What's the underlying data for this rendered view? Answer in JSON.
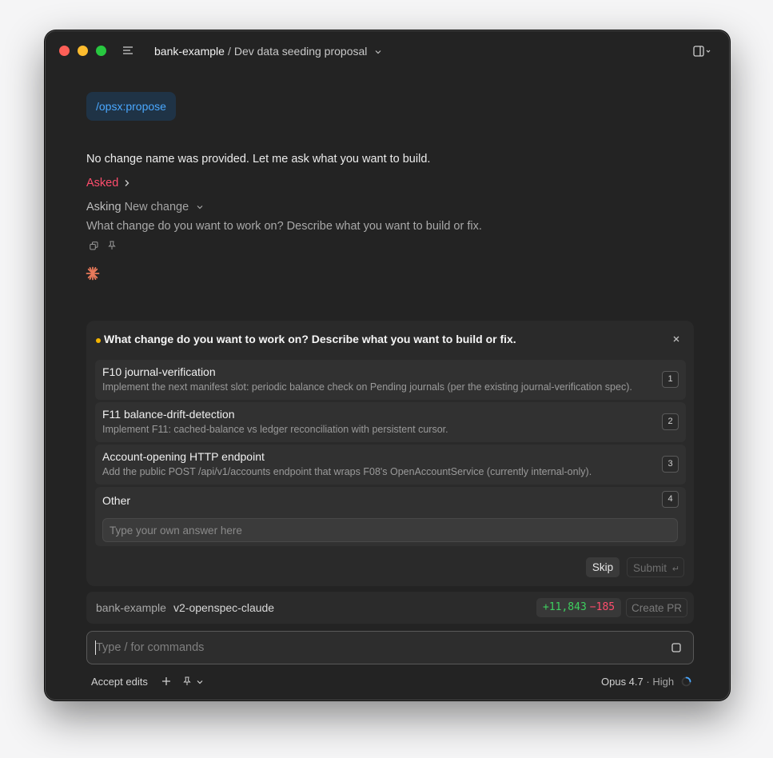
{
  "window": {
    "project": "bank-example",
    "separator": "/",
    "title": "Dev data seeding proposal"
  },
  "conversation": {
    "command_chip": "/opsx:propose",
    "assistant_message": "No change name was provided. Let me ask what you want to build.",
    "asked_label": "Asked",
    "asking_label": "Asking",
    "asking_value": "New change",
    "question": "What change do you want to work on? Describe what you want to build or fix."
  },
  "question_card": {
    "title": "What change do you want to work on? Describe what you want to build or fix.",
    "options": [
      {
        "label": "F10 journal-verification",
        "description": "Implement the next manifest slot: periodic balance check on Pending journals (per the existing journal-verification spec).",
        "key": "1"
      },
      {
        "label": "F11 balance-drift-detection",
        "description": "Implement F11: cached-balance vs ledger reconciliation with persistent cursor.",
        "key": "2"
      },
      {
        "label": "Account-opening HTTP endpoint",
        "description": "Add the public POST /api/v1/accounts endpoint that wraps F08's OpenAccountService (currently internal-only).",
        "key": "3"
      }
    ],
    "other": {
      "label": "Other",
      "key": "4",
      "placeholder": "Type your own answer here"
    },
    "skip_label": "Skip",
    "submit_label": "Submit",
    "submit_icon": "↵"
  },
  "status_bar": {
    "repo": "bank-example",
    "branch": "v2-openspec-claude",
    "additions": "+11,843",
    "deletions": "−185",
    "create_pr_label": "Create PR"
  },
  "composer": {
    "placeholder": "Type / for commands"
  },
  "footer": {
    "mode": "Accept edits",
    "model": "Opus 4.7",
    "separator": " · ",
    "effort": "High"
  },
  "colors": {
    "window_bg": "#232323",
    "command_chip_text": "#4aa8ff",
    "asked": "#ff4d6d",
    "additions": "#3ecf5f",
    "deletions": "#ff4d6d",
    "question_dot": "#f4b400",
    "spark": "#e8795a"
  }
}
